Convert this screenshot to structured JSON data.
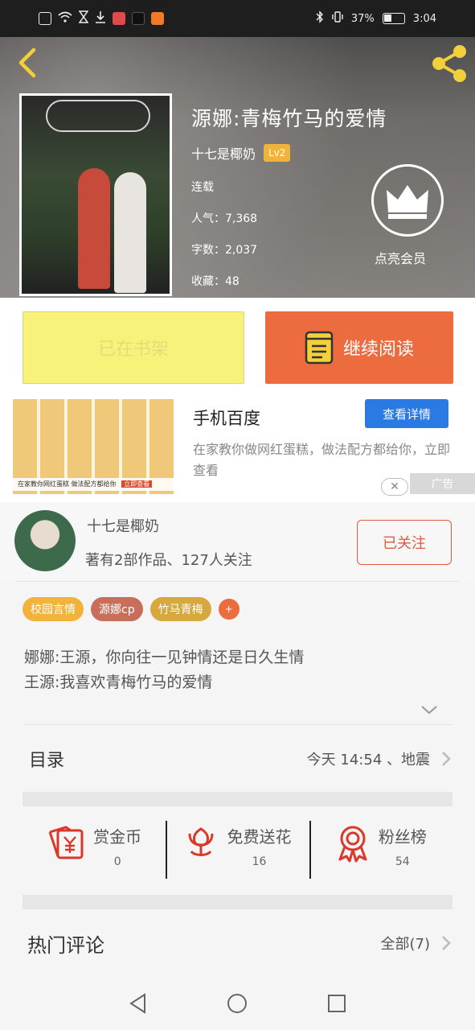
{
  "status_bar": {
    "battery": "37%",
    "time": "3:04"
  },
  "book": {
    "title": "源娜:青梅竹马的爱情",
    "author": "十七是椰奶",
    "level": "Lv2",
    "status": "连载",
    "popularity_label": "人气：7,368",
    "word_count_label": "字数：2,037",
    "favorites_label": "收藏：48"
  },
  "vip": {
    "label": "点亮会员",
    "icon": "crown-icon"
  },
  "buttons": {
    "shelf": "已在书架",
    "continue": "继续阅读"
  },
  "ad": {
    "title": "手机百度",
    "button": "查看详情",
    "description": "在家教你做网红蛋糕，做法配方都给你，立即查看",
    "image_caption": "在家教你网红蛋糕 做法配方都给你",
    "image_cta": "立即查看",
    "close": "✕",
    "tag": "广告"
  },
  "author_card": {
    "name": "十七是椰奶",
    "stats": "著有2部作品、127人关注",
    "follow": "已关注"
  },
  "tags": [
    {
      "label": "校园言情",
      "color": "#f3b23a"
    },
    {
      "label": "源娜cp",
      "color": "#c96e5a"
    },
    {
      "label": "竹马青梅",
      "color": "#d6a83e"
    }
  ],
  "tag_add": "+",
  "synopsis": {
    "line1": "娜娜:王源，你向往一见钟情还是日久生情",
    "line2": "王源:我喜欢青梅竹马的爱情"
  },
  "toc": {
    "label": "目录",
    "latest": "今天 14:54 、地震"
  },
  "actions": [
    {
      "label": "赏金币",
      "count": "0",
      "icon": "red-envelope-icon"
    },
    {
      "label": "免费送花",
      "count": "16",
      "icon": "flower-icon"
    },
    {
      "label": "粉丝榜",
      "count": "54",
      "icon": "medal-icon"
    }
  ],
  "comments": {
    "title": "热门评论",
    "all": "全部(7)"
  },
  "colors": {
    "accent": "#ec6b3f",
    "shelf_button": "#f8f17a",
    "ad_button": "#2b7ae4",
    "icon_red": "#d9382a"
  }
}
